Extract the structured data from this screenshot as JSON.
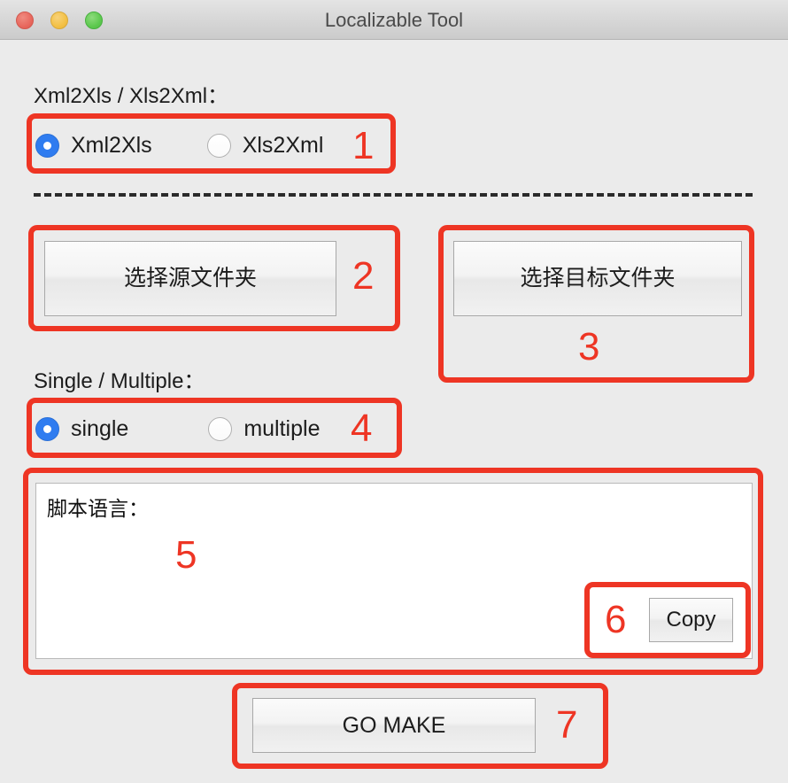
{
  "window": {
    "title": "Localizable Tool",
    "controls": {
      "close": "close-button",
      "minimize": "minimize-button",
      "maximize": "maximize-button"
    },
    "accent_blue": "#2f7cf0",
    "annotation_red": "#ee3524",
    "background": "#ebebeb"
  },
  "sections": {
    "convert_mode": {
      "label": "Xml2Xls / Xls2Xml：",
      "options": [
        {
          "label": "Xml2Xls",
          "selected": true
        },
        {
          "label": "Xls2Xml",
          "selected": false
        }
      ]
    },
    "folders": {
      "source_button": "选择源文件夹",
      "target_button": "选择目标文件夹"
    },
    "mode": {
      "label": "Single / Multiple：",
      "options": [
        {
          "label": "single",
          "selected": true
        },
        {
          "label": "multiple",
          "selected": false
        }
      ]
    },
    "output": {
      "text": "脚本语言：",
      "copy_button": "Copy"
    },
    "action": {
      "go_button": "GO MAKE"
    }
  },
  "annotations": [
    {
      "number": "1",
      "target": "convert-mode-radio-group"
    },
    {
      "number": "2",
      "target": "select-source-folder-button"
    },
    {
      "number": "3",
      "target": "select-target-folder-button"
    },
    {
      "number": "4",
      "target": "single-multiple-radio-group"
    },
    {
      "number": "5",
      "target": "script-output-textarea"
    },
    {
      "number": "6",
      "target": "copy-button"
    },
    {
      "number": "7",
      "target": "go-make-button"
    }
  ]
}
